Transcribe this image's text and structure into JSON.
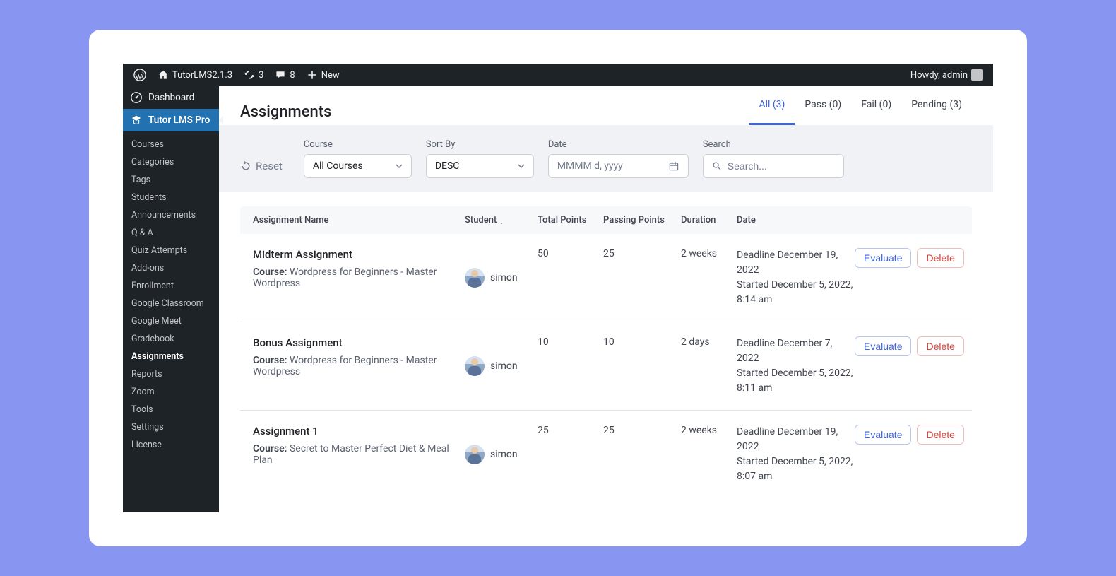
{
  "adminbar": {
    "site_name": "TutorLMS2.1.3",
    "updates_count": "3",
    "comments_count": "8",
    "new_label": "New",
    "greeting": "Howdy, admin"
  },
  "sidebar": {
    "dashboard_label": "Dashboard",
    "active_label": "Tutor LMS Pro",
    "sub_items": [
      "Courses",
      "Categories",
      "Tags",
      "Students",
      "Announcements",
      "Q & A",
      "Quiz Attempts",
      "Add-ons",
      "Enrollment",
      "Google Classroom",
      "Google Meet",
      "Gradebook",
      "Assignments",
      "Reports",
      "Zoom",
      "Tools",
      "Settings",
      "License"
    ]
  },
  "header": {
    "title": "Assignments",
    "tabs": [
      {
        "label": "All (3)"
      },
      {
        "label": "Pass (0)"
      },
      {
        "label": "Fail (0)"
      },
      {
        "label": "Pending (3)"
      }
    ]
  },
  "filters": {
    "reset_label": "Reset",
    "course_label": "Course",
    "course_value": "All Courses",
    "sort_label": "Sort By",
    "sort_value": "DESC",
    "date_label": "Date",
    "date_placeholder": "MMMM d, yyyy",
    "search_label": "Search",
    "search_placeholder": "Search..."
  },
  "table": {
    "headers": {
      "name": "Assignment Name",
      "student": "Student",
      "total": "Total Points",
      "passing": "Passing Points",
      "duration": "Duration",
      "date": "Date"
    },
    "rows": [
      {
        "title": "Midterm Assignment",
        "course_label": "Course:",
        "course": "Wordpress for Beginners - Master Wordpress",
        "student": "simon",
        "total": "50",
        "passing": "25",
        "duration": "2 weeks",
        "deadline": "Deadline December 19, 2022",
        "started": "Started December 5, 2022, 8:14 am"
      },
      {
        "title": "Bonus Assignment",
        "course_label": "Course:",
        "course": "Wordpress for Beginners - Master Wordpress",
        "student": "simon",
        "total": "10",
        "passing": "10",
        "duration": "2 days",
        "deadline": "Deadline December 7, 2022",
        "started": "Started December 5, 2022, 8:11 am"
      },
      {
        "title": "Assignment 1",
        "course_label": "Course:",
        "course": "Secret to Master Perfect Diet & Meal Plan",
        "student": "simon",
        "total": "25",
        "passing": "25",
        "duration": "2 weeks",
        "deadline": "Deadline December 19, 2022",
        "started": "Started December 5, 2022, 8:07 am"
      }
    ]
  },
  "buttons": {
    "evaluate": "Evaluate",
    "delete": "Delete"
  }
}
